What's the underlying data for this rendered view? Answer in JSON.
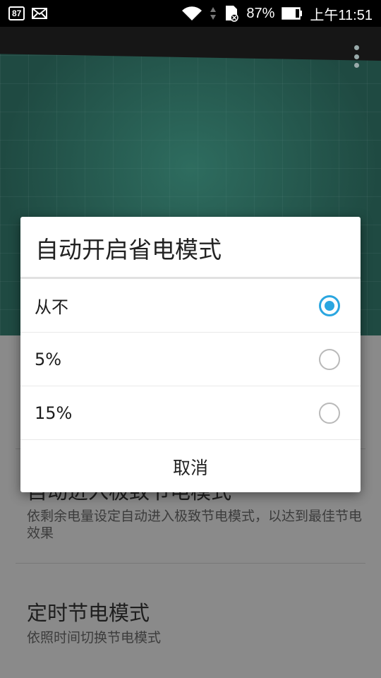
{
  "status_bar": {
    "notification_badge": "87",
    "battery_percent": "87%",
    "time": "上午11:51"
  },
  "settings": [
    {
      "title": "自动进入极致节电模式",
      "subtitle": "依剩余电量设定自动进入极致节电模式，以达到最佳节电效果"
    },
    {
      "title": "定时节电模式",
      "subtitle": "依照时间切换节电模式"
    }
  ],
  "dialog": {
    "title": "自动开启省电模式",
    "options": [
      {
        "label": "从不",
        "selected": true
      },
      {
        "label": "5%",
        "selected": false
      },
      {
        "label": "15%",
        "selected": false
      }
    ],
    "cancel_label": "取消"
  },
  "colors": {
    "accent": "#2aa6e0",
    "hero": "#1f4a42"
  }
}
